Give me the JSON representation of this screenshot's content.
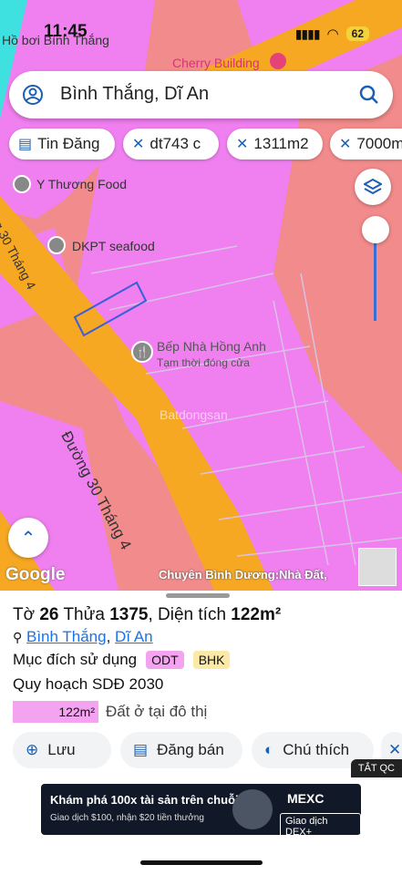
{
  "status_bar": {
    "time": "11:45",
    "battery": "62"
  },
  "map": {
    "top_label": "Hồ bơi Bình Thắng",
    "poi_cherry": "Cherry Building",
    "poi_y_thuong": "Y Thương Food",
    "poi_dkpt": "DKPT seafood",
    "poi_bep": "Bếp Nhà Hồng Anh",
    "poi_bep_status": "Tạm thời đóng cửa",
    "road_label": "Đường 30 Tháng 4",
    "road_left": "g 30 Tháng 4",
    "watermark": "Batdongsan",
    "google": "Google",
    "ad_caption": "Chuyên Bình Dương:Nhà Đất,"
  },
  "search": {
    "text": "Bình Thắng, Dĩ An"
  },
  "chips": [
    {
      "label": "Tin Đăng"
    },
    {
      "label": "dt743 c"
    },
    {
      "label": "1311m2"
    },
    {
      "label": "7000m"
    }
  ],
  "info": {
    "sheet": "Tờ",
    "sheet_no": "26",
    "parcel": "Thửa",
    "parcel_no": "1375",
    "area_label": "Diện tích",
    "area_value": "122m²",
    "ward": "Bình Thắng",
    "district": "Dĩ An",
    "purpose_label": "Mục đích sử dụng",
    "purpose_tags": [
      "ODT",
      "BHK"
    ],
    "plan_label": "Quy hoạch SDĐ 2030",
    "plan_area": "122m²",
    "plan_desc": "Đất ở tại đô thị"
  },
  "actions": {
    "save": "Lưu",
    "post": "Đăng bán",
    "legend": "Chú thích"
  },
  "ad": {
    "hide": "TẮT QC",
    "headline": "Khám phá 100x tài sản trên chuỗi",
    "sub": "Giao dịch $100, nhận $20 tiền thưởng",
    "brand": "MEXC",
    "cta": "Giao dịch DEX+"
  },
  "colors": {
    "map_bg": "#f28b8b",
    "land_pink": "#f07ff0",
    "road_orange": "#f7a823",
    "water_cyan": "#3fe0e0",
    "link_blue": "#1a73e8"
  }
}
